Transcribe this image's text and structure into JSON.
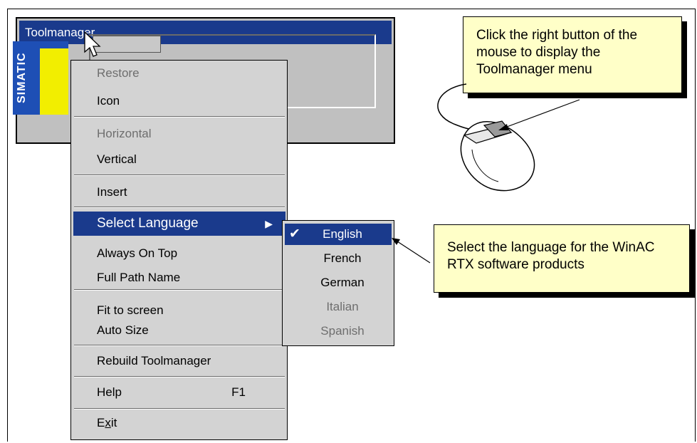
{
  "window": {
    "title": "Toolmanager",
    "logo_text": "SIMATIC"
  },
  "context_menu": {
    "items": [
      {
        "label": "Restore",
        "disabled": true
      },
      {
        "label": "Icon",
        "disabled": false
      },
      {
        "label": "Horizontal",
        "disabled": true
      },
      {
        "label": "Vertical",
        "disabled": false
      },
      {
        "label": "Insert",
        "disabled": false
      },
      {
        "label": "Select Language",
        "disabled": false,
        "selected": true,
        "has_submenu": true
      },
      {
        "label": "Always On Top",
        "disabled": false
      },
      {
        "label": "Full Path Name",
        "disabled": false
      },
      {
        "label": "Fit to screen",
        "disabled": false
      },
      {
        "label": "Auto Size",
        "disabled": false
      },
      {
        "label": "Rebuild Toolmanager",
        "disabled": false
      },
      {
        "label": "Help",
        "shortcut": "F1",
        "disabled": false
      },
      {
        "label": "Exit",
        "mnemonic_underline": "x",
        "disabled": false
      }
    ],
    "help_shortcut": "F1",
    "exit_prefix": "E",
    "exit_mnemonic": "x",
    "exit_suffix": "it"
  },
  "language_submenu": {
    "items": [
      {
        "label": "English",
        "checked": true,
        "disabled": false
      },
      {
        "label": "French",
        "disabled": false
      },
      {
        "label": "German",
        "disabled": false
      },
      {
        "label": "Italian",
        "disabled": true
      },
      {
        "label": "Spanish",
        "disabled": true
      }
    ]
  },
  "callouts": {
    "mouse_note": "Click the right button of the mouse to display the Toolmanager menu",
    "language_note": "Select the language for the WinAC RTX software products"
  },
  "colors": {
    "title_bar": "#1a3a8c",
    "menu_bg": "#d3d3d3",
    "highlight": "#1a3a8c",
    "callout_bg": "#ffffc8",
    "simatic_blue": "#1e4fb5",
    "simatic_yellow": "#f2ee00"
  },
  "icons": [
    "mouse-pointer-icon",
    "checkmark-icon",
    "submenu-arrow-icon",
    "mouse-device-icon"
  ]
}
